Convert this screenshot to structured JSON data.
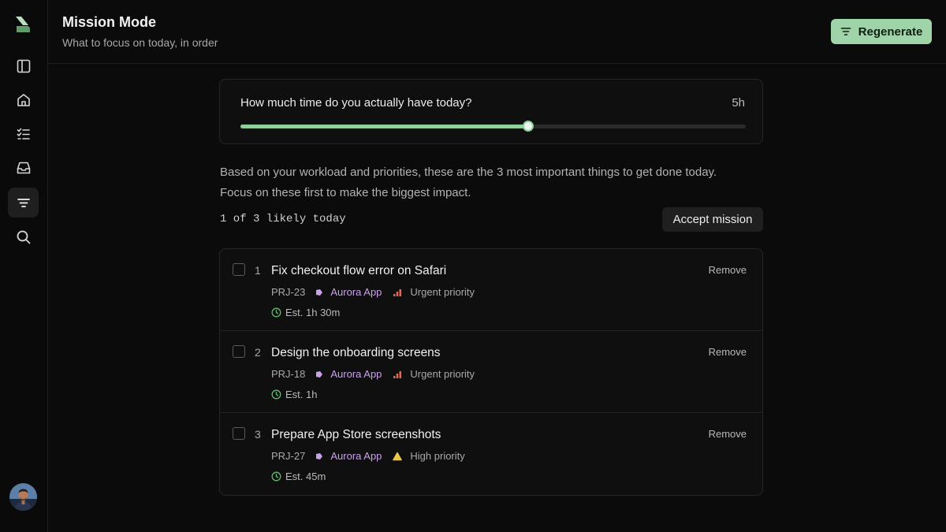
{
  "header": {
    "title": "Mission Mode",
    "subtitle": "What to focus on today, in order",
    "regenerate_label": "Regenerate"
  },
  "sidebar": {
    "items": [
      {
        "name": "panel",
        "icon": "panel-icon"
      },
      {
        "name": "home",
        "icon": "home-icon"
      },
      {
        "name": "tasks",
        "icon": "checklist-icon"
      },
      {
        "name": "inbox",
        "icon": "inbox-icon"
      },
      {
        "name": "mission",
        "icon": "filter-icon",
        "active": true
      },
      {
        "name": "search",
        "icon": "search-icon"
      }
    ]
  },
  "time": {
    "question": "How much time do you actually have today?",
    "value_label": "5h",
    "slider_fraction": 0.57
  },
  "description": {
    "line1": "Based on your workload and priorities, these are the 3 most important things to get done today.",
    "line2": "Focus on these first to make the biggest impact."
  },
  "summary": {
    "count_text": "1 of 3 likely today",
    "accept_label": "Accept mission"
  },
  "tasks": [
    {
      "num": "1",
      "title": "Fix checkout flow error on Safari",
      "id": "PRJ-23",
      "project": "Aurora App",
      "priority": "Urgent priority",
      "priority_level": "urgent",
      "estimate": "Est. 1h 30m",
      "remove": "Remove"
    },
    {
      "num": "2",
      "title": "Design the onboarding screens",
      "id": "PRJ-18",
      "project": "Aurora App",
      "priority": "Urgent priority",
      "priority_level": "urgent",
      "estimate": "Est. 1h",
      "remove": "Remove"
    },
    {
      "num": "3",
      "title": "Prepare App Store screenshots",
      "id": "PRJ-27",
      "project": "Aurora App",
      "priority": "High priority",
      "priority_level": "high",
      "estimate": "Est. 45m",
      "remove": "Remove"
    }
  ],
  "colors": {
    "accent": "#9fd4a8",
    "project": "#c9a2e6",
    "urgent": "#e0685a",
    "high": "#e8c84a",
    "clock": "#57c06a"
  }
}
